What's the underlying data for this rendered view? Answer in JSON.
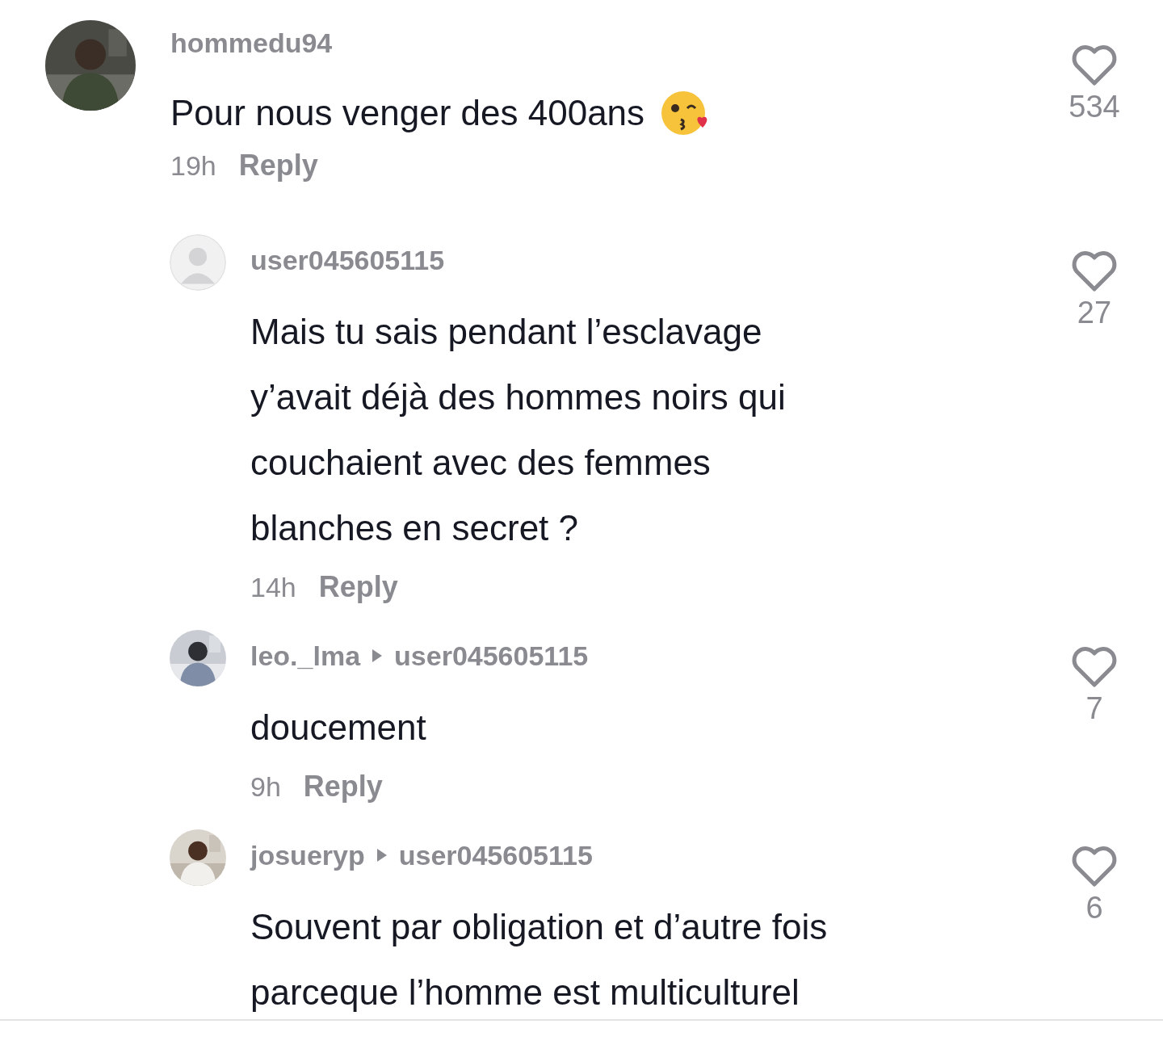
{
  "comments": [
    {
      "username": "hommedu94",
      "avatar": {
        "kind": "picture"
      },
      "lines": [
        "Pour nous venger des 400ans"
      ],
      "emoji": {
        "kind": "kiss"
      },
      "time": "19h",
      "reply_label": "Reply",
      "likes": "534",
      "replies": [
        {
          "username": "user045605115",
          "avatar": {
            "kind": "default"
          },
          "lines": [
            "Mais tu sais pendant l’esclavage",
            "y’avait déjà des hommes noirs qui",
            "couchaient avec des femmes",
            "blanches en secret ?"
          ],
          "time": "14h",
          "reply_label": "Reply",
          "likes": "27"
        },
        {
          "username": "leo._lma",
          "reply_to": "user045605115",
          "avatar": {
            "kind": "picture"
          },
          "lines": [
            "doucement"
          ],
          "time": "9h",
          "reply_label": "Reply",
          "likes": "7"
        },
        {
          "username": "josueryp",
          "reply_to": "user045605115",
          "avatar": {
            "kind": "picture"
          },
          "lines": [
            "Souvent par obligation et d’autre fois",
            "parceque l’homme est multiculturel"
          ],
          "likes": "6"
        }
      ]
    }
  ]
}
